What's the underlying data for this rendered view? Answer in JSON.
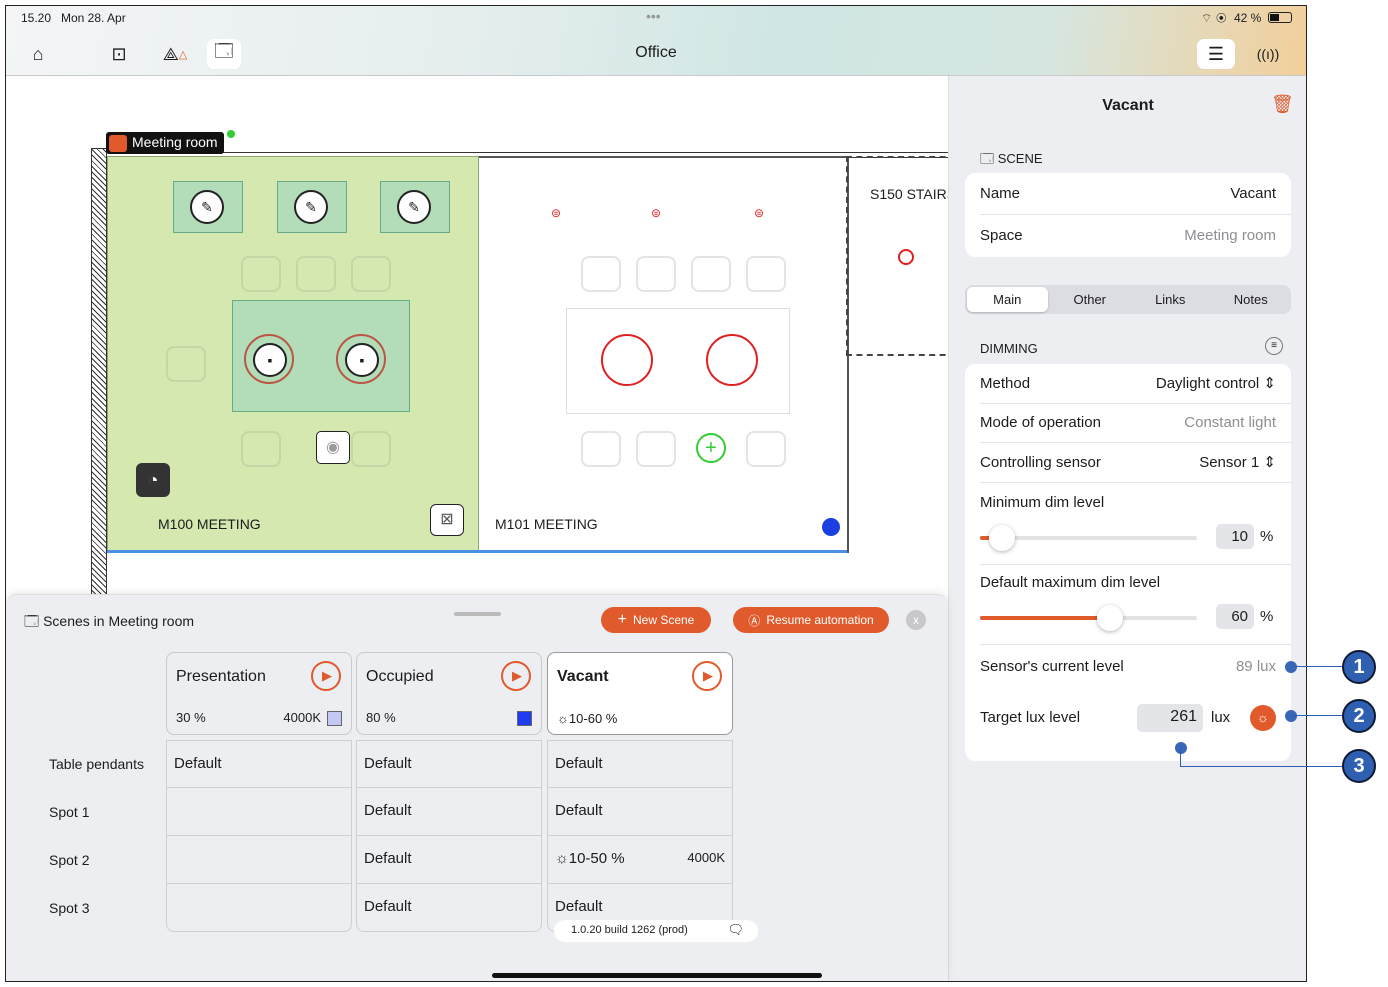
{
  "status_bar": {
    "time": "15.20",
    "date": "Mon 28. Apr",
    "battery": "42 %"
  },
  "header": {
    "title": "Office",
    "icons": [
      "home-icon",
      "floorplan-icon",
      "network-warning-icon",
      "scenes-icon",
      "sliders-icon",
      "antenna-icon"
    ]
  },
  "map": {
    "selected_space": "Meeting room",
    "rooms": [
      "M100 MEETING",
      "M101 MEETING",
      "S150 STAIRS"
    ]
  },
  "panel": {
    "title": "Vacant",
    "section_scene": "SCENE",
    "name_label": "Name",
    "name_value": "Vacant",
    "space_label": "Space",
    "space_value": "Meeting room",
    "tabs": [
      {
        "label": "Main",
        "selected": true
      },
      {
        "label": "Other"
      },
      {
        "label": "Links"
      },
      {
        "label": "Notes"
      }
    ],
    "section_dimming": "DIMMING",
    "method_label": "Method",
    "method_value": "Daylight control",
    "mode_label": "Mode of operation",
    "mode_value": "Constant light",
    "sensor_label": "Controlling sensor",
    "sensor_value": "Sensor 1",
    "min_dim_label": "Minimum dim level",
    "min_dim_value": "10",
    "min_dim_unit": "%",
    "min_dim_percent": 10,
    "max_dim_label": "Default maximum dim level",
    "max_dim_value": "60",
    "max_dim_unit": "%",
    "max_dim_percent": 60,
    "current_label": "Sensor's current level",
    "current_value": "89 lux",
    "target_label": "Target lux level",
    "target_value": "261",
    "target_unit": "lux",
    "accent": "#e05a2b"
  },
  "callouts": [
    "1",
    "2",
    "3"
  ],
  "sheet": {
    "title": "Scenes in Meeting room",
    "new_scene": "New Scene",
    "resume": "Resume automation",
    "close": "x",
    "scenes": [
      {
        "name": "Presentation",
        "level": "30 %",
        "cct": "4000K",
        "color": "#c3c8f5"
      },
      {
        "name": "Occupied",
        "level": "80 %",
        "cct": "",
        "color": "#1f3cf0"
      },
      {
        "name": "Vacant",
        "level": "10-60 %",
        "cct": "",
        "selected": true
      }
    ],
    "rows": [
      {
        "label": "Table pendants",
        "cells": [
          {
            "v": "Default"
          },
          {
            "v": "Default"
          },
          {
            "v": "Default"
          }
        ]
      },
      {
        "label": "Spot 1",
        "cells": [
          {
            "v": ""
          },
          {
            "v": "Default"
          },
          {
            "v": "Default"
          }
        ]
      },
      {
        "label": "Spot 2",
        "cells": [
          {
            "v": ""
          },
          {
            "v": "Default"
          },
          {
            "v": "10-50 %",
            "k": "4000K"
          }
        ]
      },
      {
        "label": "Spot 3",
        "cells": [
          {
            "v": ""
          },
          {
            "v": "Default"
          },
          {
            "v": "Default"
          }
        ]
      }
    ],
    "build": "1.0.20 build 1262 (prod)"
  }
}
